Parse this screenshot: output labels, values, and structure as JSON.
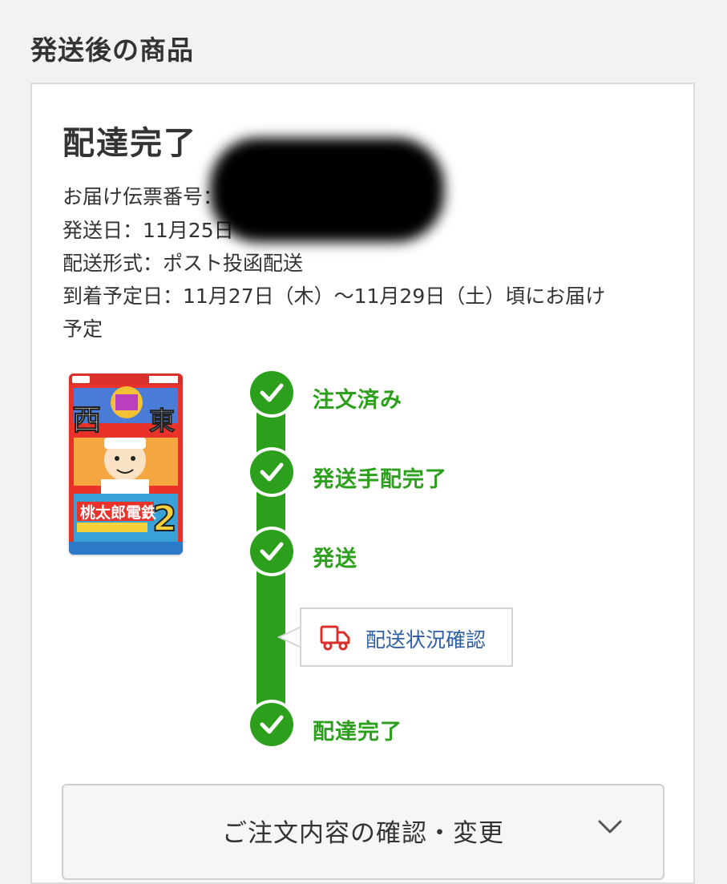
{
  "section_title": "発送後の商品",
  "shipment": {
    "status_heading": "配達完了",
    "tracking_number_label": "お届け伝票番号：",
    "ship_date": "発送日：11月25日",
    "delivery_method": "配送形式：ポスト投函配送",
    "expected_arrival_line1": "到着予定日：11月27日（木）〜11月29日（土）頃にお届け",
    "expected_arrival_line2": "予定"
  },
  "product": {
    "image_icon": "game-box-art",
    "title_text": "桃太郎電鉄",
    "number_text": "2"
  },
  "progress": {
    "color": "#2ca01c",
    "steps": [
      {
        "label": "注文済み",
        "done": true
      },
      {
        "label": "発送手配完了",
        "done": true
      },
      {
        "label": "発送",
        "done": true
      },
      {
        "label": "配達完了",
        "done": true
      }
    ],
    "tracking_link": {
      "label": "配送状況確認",
      "icon": "truck-icon",
      "icon_color": "#d9302b",
      "text_color": "#2f5fa5"
    }
  },
  "order_button": {
    "label": "ご注文内容の確認・変更",
    "icon": "chevron-down-icon"
  }
}
